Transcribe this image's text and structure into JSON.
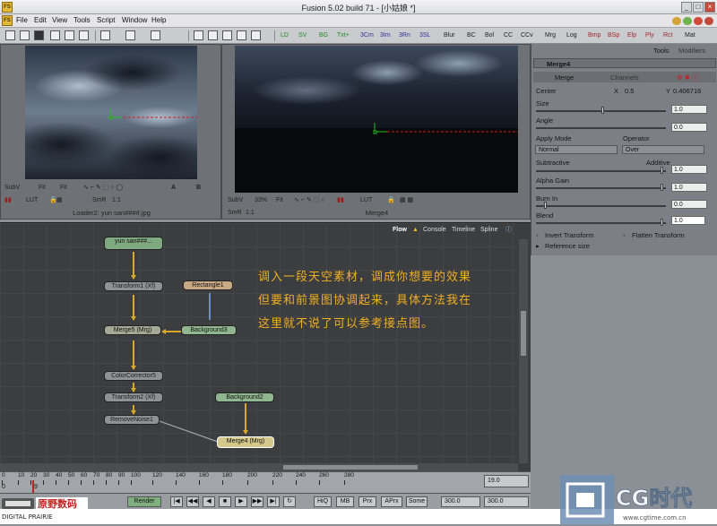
{
  "app": {
    "title": "Fusion 5.02 build 71 - [小姑娘 *]",
    "icon_label": "FS"
  },
  "menu": [
    "File",
    "Edit",
    "View",
    "Tools",
    "Script",
    "Window",
    "Help"
  ],
  "toolbar": {
    "items": [
      "LD",
      "SV",
      "BG",
      "Txt+",
      "3Cm",
      "3Im",
      "3Rn",
      "3SL",
      "Blur",
      "BC",
      "Bol",
      "CC",
      "CCv",
      "Mrg",
      "Log",
      "Bmp",
      "BSp",
      "Elp",
      "Ply",
      "Rct",
      "Mat"
    ]
  },
  "viewer_left": {
    "caption": "Loader2: yun san####.jpg",
    "tools": [
      "SubV",
      "Fit",
      "Fit",
      "LUT",
      "SmR",
      "1:1",
      "A",
      "B"
    ]
  },
  "viewer_right": {
    "caption": "Merge4",
    "tools": [
      "SubV",
      "33%",
      "Fit",
      "LUT",
      "SmR",
      "1:1"
    ]
  },
  "panel": {
    "tabs": [
      "Tools",
      "Modifiers"
    ],
    "tool_name": "Merge4",
    "subtabs": [
      "Merge",
      "Channels"
    ],
    "center_label": "Center",
    "x_label": "X",
    "x_value": "0.5",
    "y_label": "Y",
    "y_value": "0.406716",
    "size_label": "Size",
    "size_value": "1.0",
    "angle_label": "Angle",
    "angle_value": "0.0",
    "apply_mode_label": "Apply Mode",
    "apply_mode_value": "Normal",
    "operator_label": "Operator",
    "operator_value": "Over",
    "subtractive_label": "Subtractive",
    "additive_label": "Additive",
    "subadd_value": "1.0",
    "alpha_gain_label": "Alpha Gain",
    "alpha_gain_value": "1.0",
    "burn_in_label": "Burn In",
    "burn_in_value": "0.0",
    "blend_label": "Blend",
    "blend_value": "1.0",
    "invert_transform": "Invert Transform",
    "flatten_transform": "Flatten Transform",
    "reference_size": "Reference size"
  },
  "flow": {
    "tabs": [
      "Flow",
      "Console",
      "Timeline",
      "Spline"
    ],
    "nodes": {
      "loader": "yun san###...",
      "transform1": "Transform1 (Xf)",
      "rectangle1": "Rectangle1",
      "merge5": "Merge5 (Mrg)",
      "background3": "Background3",
      "colorcorrector5": "ColorCorrector5",
      "transform2": "Transform2 (Xf)",
      "removenoise1": "RemoveNoise1",
      "background2": "Background2",
      "merge4": "Merge4 (Mrg)"
    },
    "annotation": [
      "调入一段天空素材，调成你想要的效果",
      "但要和前景图协调起来，具体方法我在",
      "这里就不说了可以参考接点图。"
    ]
  },
  "timeline": {
    "ticks": [
      "0",
      "10",
      "20",
      "30",
      "40",
      "50",
      "60",
      "70",
      "80",
      "90",
      "100",
      "120",
      "140",
      "160",
      "180",
      "200",
      "220",
      "240",
      "260",
      "280"
    ],
    "start": "0",
    "current": "9",
    "end_value": "19.0"
  },
  "playbar": {
    "render_label": "Render",
    "hiq": "HiQ",
    "mb": "MB",
    "prx": "Prx",
    "aprx": "APrx",
    "some": "Some",
    "render_end": "300.0",
    "global_end": "300.0"
  },
  "logos": {
    "left_cn": "原野数码",
    "left_en": "DIGITAL PRAIRIE",
    "right_main": "CG时代",
    "right_url": "www.cgtime.com.cn"
  },
  "colors": {
    "annotation": "#f0b020",
    "wire": "#d7a82a"
  }
}
